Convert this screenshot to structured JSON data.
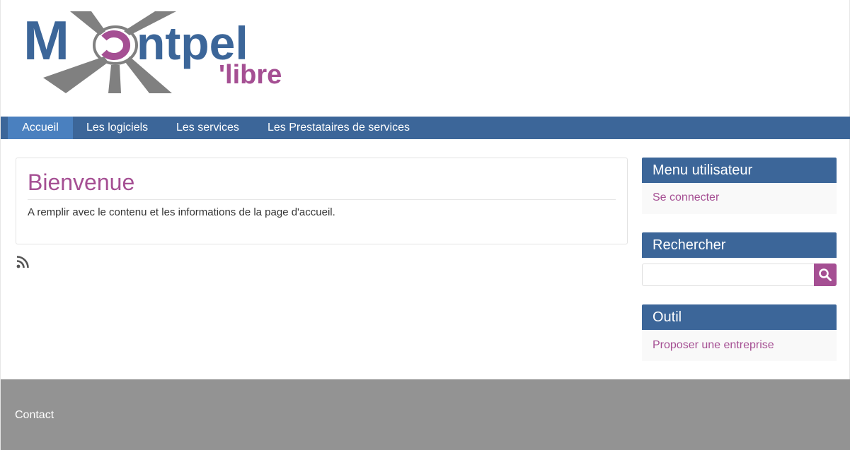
{
  "header": {
    "logo": {
      "wordmark_first": "M",
      "wordmark_rest": "ntpel",
      "tagline": "'libre",
      "colors": {
        "blue": "#3c6699",
        "magenta": "#a54f93",
        "gray": "#808080"
      }
    }
  },
  "nav": {
    "items": [
      {
        "label": "Accueil",
        "active": true
      },
      {
        "label": "Les logiciels",
        "active": false
      },
      {
        "label": "Les services",
        "active": false
      },
      {
        "label": "Les Prestataires de services",
        "active": false
      }
    ]
  },
  "main": {
    "title": "Bienvenue",
    "text": "A remplir avec le contenu et les informations de la page d'accueil.",
    "feed_icon": "rss-icon"
  },
  "sidebar": {
    "user_menu": {
      "title": "Menu utilisateur",
      "link": "Se connecter"
    },
    "search": {
      "title": "Rechercher",
      "placeholder": "",
      "value": "",
      "icon": "search-icon"
    },
    "tool": {
      "title": "Outil",
      "link": "Proposer une entreprise"
    }
  },
  "footer": {
    "contact": "Contact"
  },
  "theme": {
    "primary": "#3c6699",
    "active_nav": "#4a80bf",
    "accent": "#a54f93",
    "footer_bg": "#939393"
  }
}
